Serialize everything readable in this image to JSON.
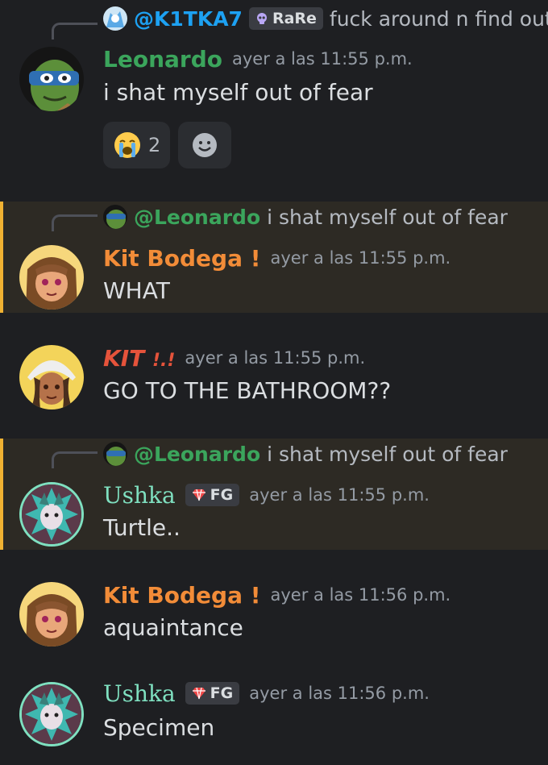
{
  "messages": [
    {
      "reply": {
        "username": "@K1TKA7",
        "tag": "RaRe",
        "text": "fuck around n find out"
      },
      "author": "Leonardo",
      "timestamp": "ayer a las 11:55 p.m.",
      "content": "i shat myself out of fear",
      "reactions": [
        {
          "emoji": "loudly-crying-face",
          "count": "2"
        }
      ],
      "colors": {
        "name": "#3ba55c"
      }
    },
    {
      "reply": {
        "username": "@Leonardo",
        "text": "i shat myself out of fear"
      },
      "author": "Kit Bodega !",
      "timestamp": "ayer a las 11:55 p.m.",
      "content": "WHAT",
      "highlighted": true,
      "colors": {
        "name": "#f28c38"
      }
    },
    {
      "author": "KIT ",
      "author_suffix": "!.!",
      "timestamp": "ayer a las 11:55 p.m.",
      "content": "GO TO THE BATHROOM??",
      "colors": {
        "name": "#e5533b"
      }
    },
    {
      "reply": {
        "username": "@Leonardo",
        "text": "i shat myself out of fear"
      },
      "author": "Ushka",
      "tag": "FG",
      "timestamp": "ayer a las 11:55 p.m.",
      "content": "Turtle..",
      "highlighted": true,
      "colors": {
        "name": "#7fe0c0"
      }
    },
    {
      "author": "Kit Bodega !",
      "timestamp": "ayer a las 11:56 p.m.",
      "content": "aquaintance",
      "colors": {
        "name": "#f28c38"
      }
    },
    {
      "author": "Ushka",
      "tag": "FG",
      "timestamp": "ayer a las 11:56 p.m.",
      "content": "Specimen",
      "colors": {
        "name": "#7fe0c0"
      }
    }
  ],
  "colors": {
    "background": "#1e1f22",
    "mention_bg": "#2d2a24",
    "mention_bar": "#f0b232",
    "reply_blue": "#1da1f2"
  }
}
